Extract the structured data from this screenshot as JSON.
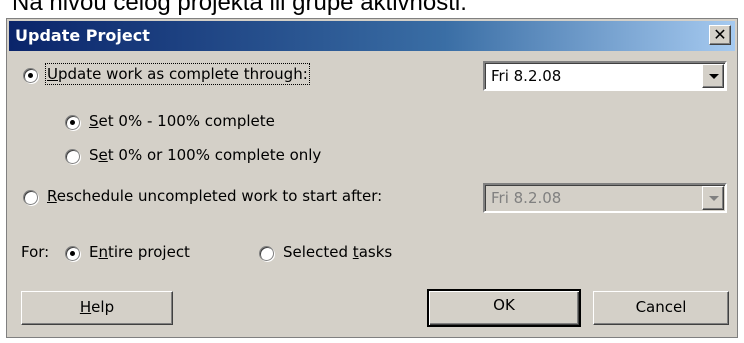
{
  "background_caption": "Na nivou celog projekta ili grupe aktivnosti.",
  "dialog": {
    "title": "Update Project",
    "close_glyph": "✕"
  },
  "update_work": {
    "label_pre": "",
    "label_mnemonic": "U",
    "label_post": "pdate work as complete through:",
    "selected": true,
    "date_value": "Fri 8.2.08"
  },
  "set_percent": {
    "label_pre": "",
    "label_mnemonic": "S",
    "label_post": "et 0% - 100% complete",
    "selected": true
  },
  "set_zero_or_full": {
    "label_pre": "S",
    "label_mnemonic": "e",
    "label_post": "t 0% or 100% complete only",
    "selected": false
  },
  "reschedule": {
    "label_pre": "",
    "label_mnemonic": "R",
    "label_post": "eschedule uncompleted work to start after:",
    "selected": false,
    "date_value": "Fri 8.2.08",
    "date_disabled": true
  },
  "scope": {
    "label": "For:",
    "entire_pre": "E",
    "entire_mnemonic": "n",
    "entire_post": "tire project",
    "entire_selected": true,
    "selected_pre": "Selected ",
    "selected_mnemonic": "t",
    "selected_post": "asks",
    "selected_selected": false
  },
  "buttons": {
    "help_mnemonic": "H",
    "help_post": "elp",
    "ok": "OK",
    "cancel": "Cancel"
  },
  "colors": {
    "dialog_face": "#d4d0c8",
    "titlebar_start": "#0a246a",
    "titlebar_end": "#a6caf0",
    "title_text": "#ffffff"
  }
}
